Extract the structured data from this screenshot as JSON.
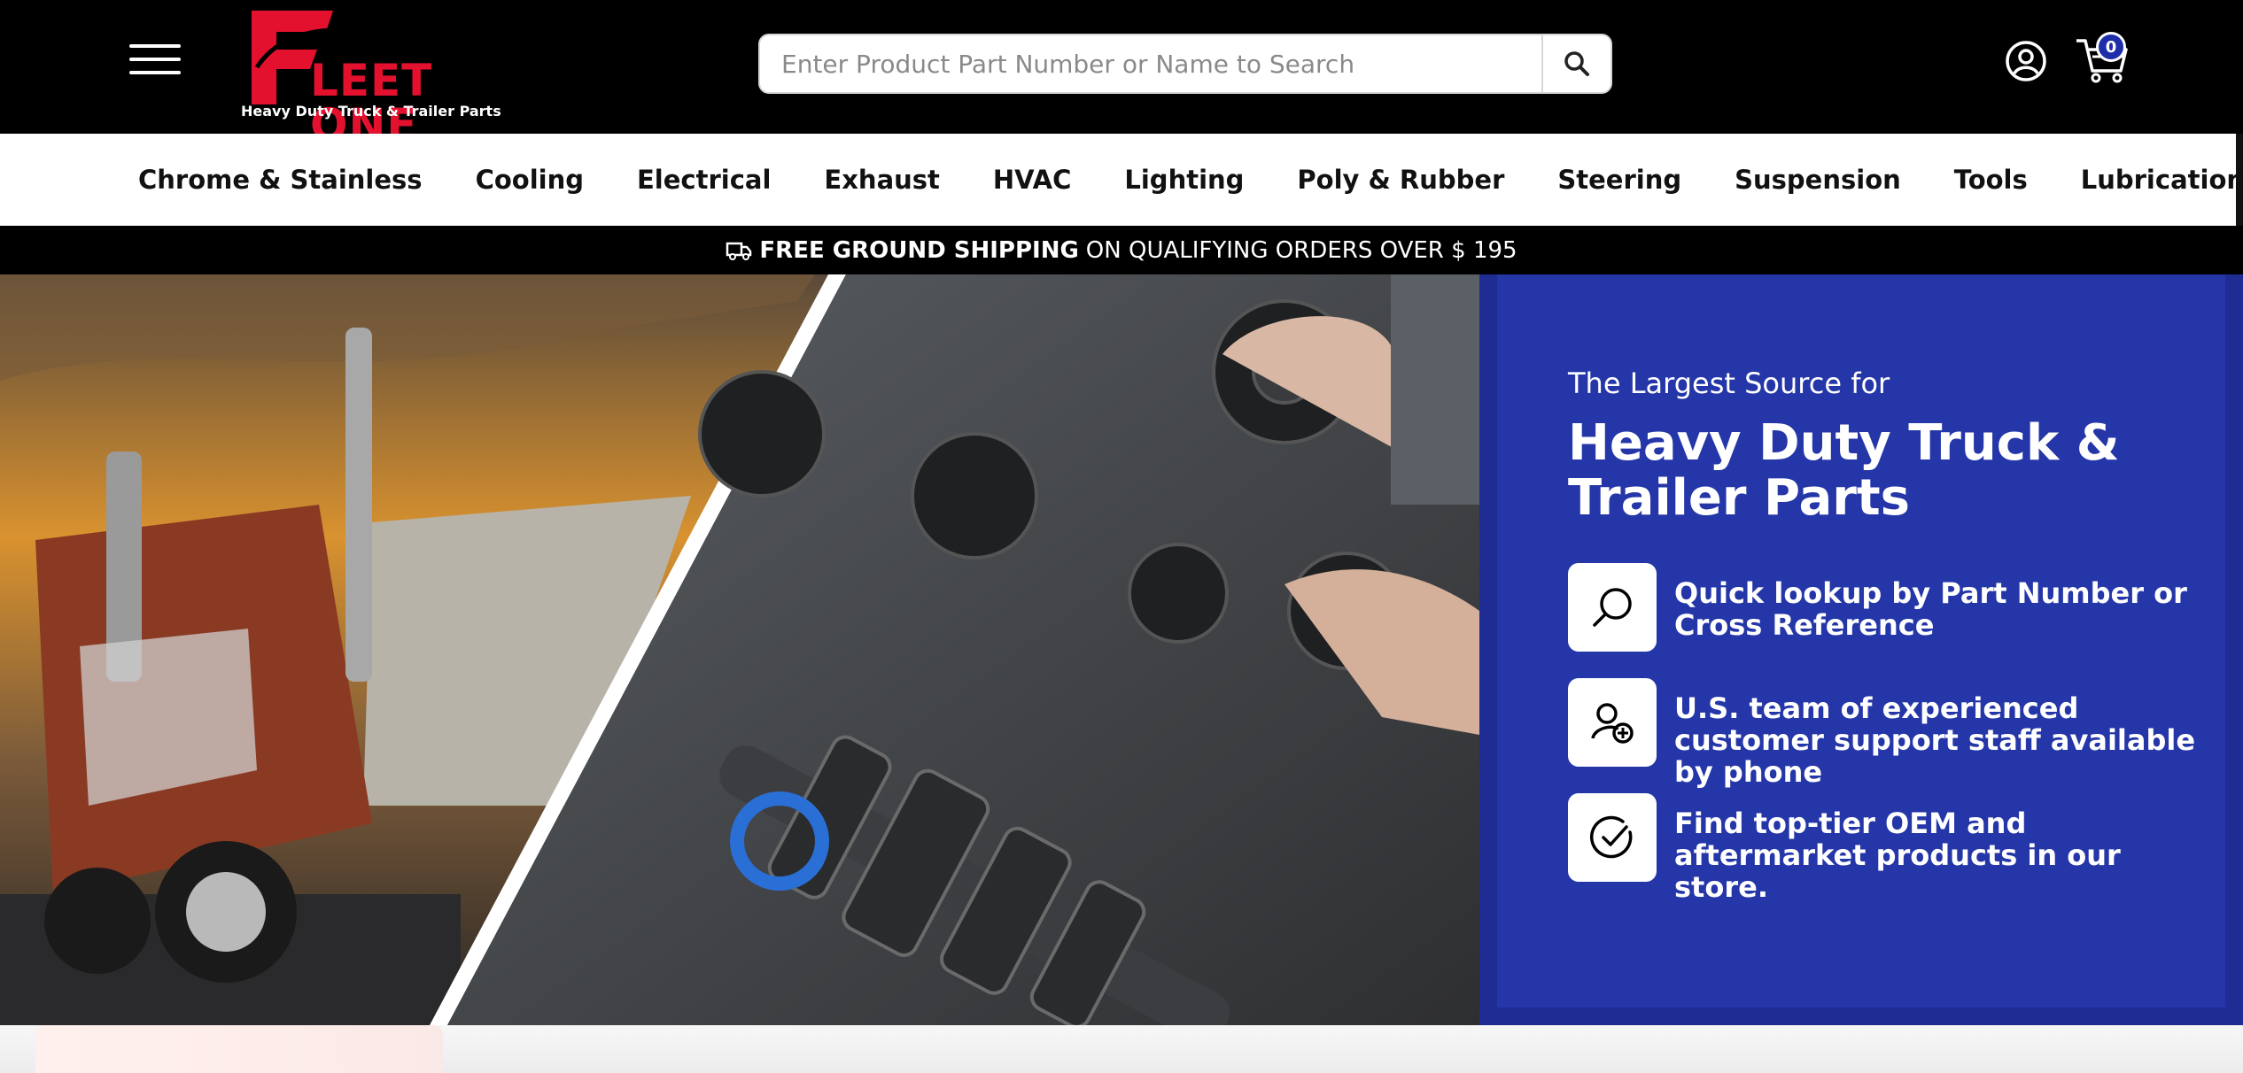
{
  "header": {
    "logo": {
      "brand": "FLEET ONE",
      "brand_rest": "LEET ONE",
      "tagline": "Heavy Duty Truck & Trailer Parts"
    },
    "search": {
      "placeholder": "Enter Product Part Number or Name to Search",
      "value": ""
    },
    "cart": {
      "count": "0"
    },
    "icons": [
      "menu-icon",
      "search-icon",
      "account-icon",
      "cart-icon"
    ]
  },
  "nav": {
    "categories": [
      "Chrome & Stainless",
      "Cooling",
      "Electrical",
      "Exhaust",
      "HVAC",
      "Lighting",
      "Poly & Rubber",
      "Steering",
      "Suspension",
      "Tools",
      "Lubrication"
    ]
  },
  "shipping": {
    "bold": "FREE GROUND SHIPPING",
    "rest": "ON QUALIFYING ORDERS OVER $ 195"
  },
  "hero": {
    "kicker": "The Largest Source for",
    "title": "Heavy Duty Truck & Trailer Parts",
    "features": [
      {
        "icon": "search-icon",
        "text": "Quick lookup by Part Number or Cross Reference"
      },
      {
        "icon": "user-plus-icon",
        "text": "U.S. team of experienced customer support staff available by phone"
      },
      {
        "icon": "check-circle-icon",
        "text": "Find top-tier OEM and aftermarket products in our store."
      }
    ]
  },
  "colors": {
    "brand_red": "#e3112e",
    "promo_blue": "#2436a8",
    "header_bg": "#000000",
    "badge_blue": "#1e2ea8"
  }
}
